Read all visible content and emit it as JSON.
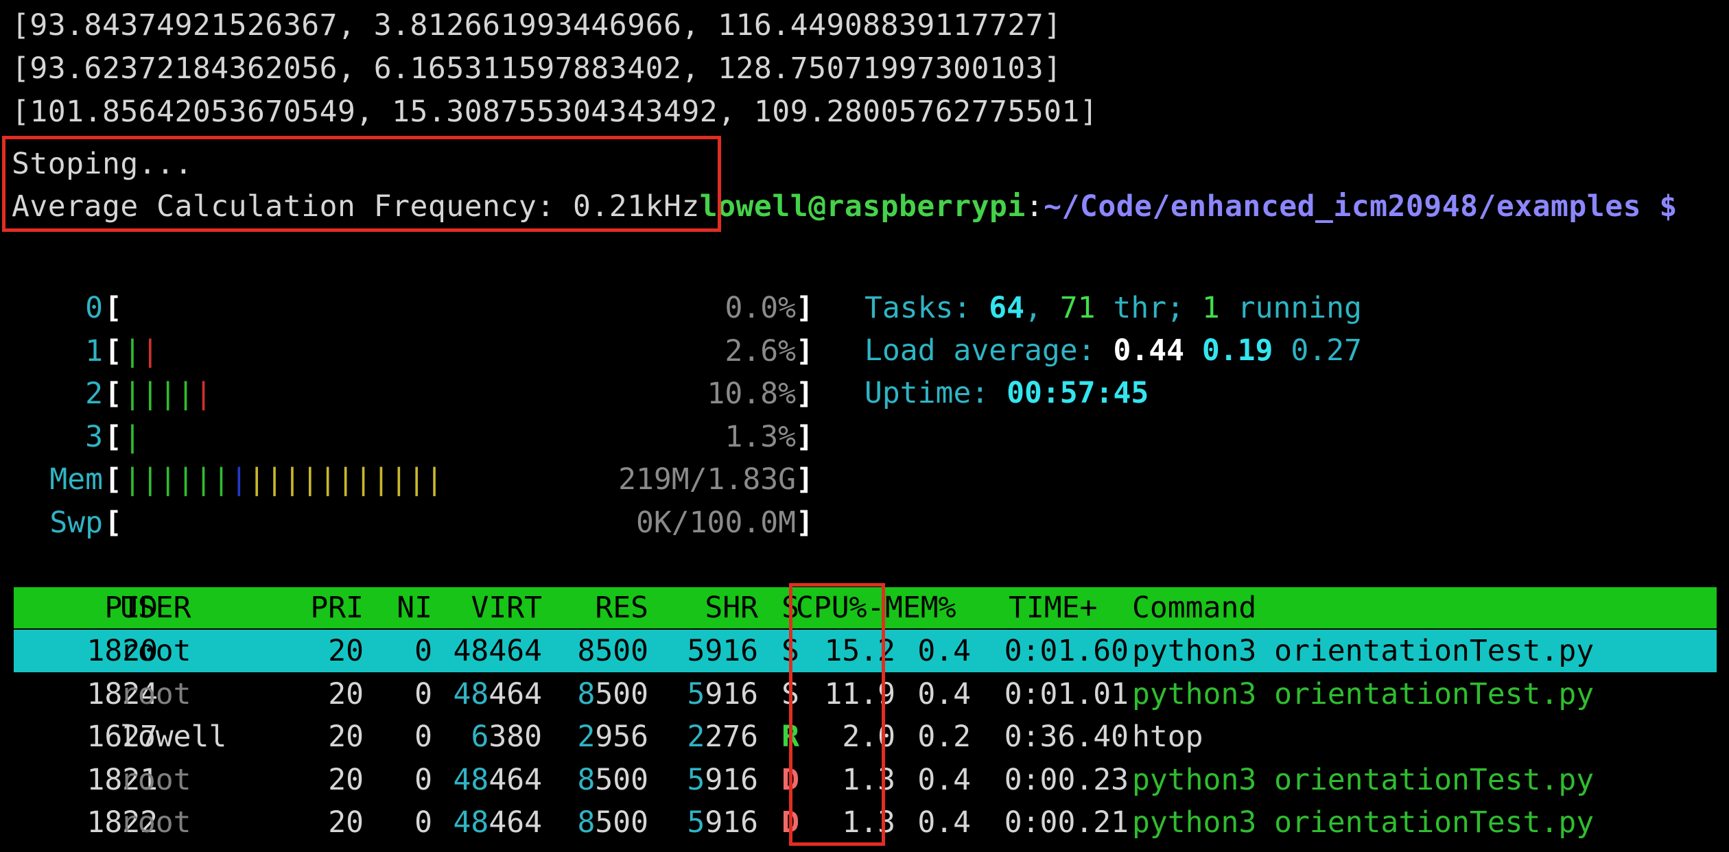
{
  "terminal": {
    "output_lines": [
      "[93.84374921526367, 3.812661993446966, 116.44908839117727]",
      "[93.62372184362056, 6.165311597883402, 128.75071997300103]",
      "[101.85642053670549, 15.308755304343492, 109.28005762775501]",
      "Stoping...",
      "Average Calculation Frequency: 0.21kHz"
    ],
    "prompt": {
      "user_host": "lowell@raspberrypi",
      "separator": ":",
      "path": "~/Code/enhanced_icm20948/examples",
      "symbol": " $"
    }
  },
  "htop": {
    "meters": [
      {
        "label": "0",
        "value": "0.0%",
        "bars": ""
      },
      {
        "label": "1",
        "value": "2.6%",
        "bars": "gr"
      },
      {
        "label": "2",
        "value": "10.8%",
        "bars": "ggggr"
      },
      {
        "label": "3",
        "value": "1.3%",
        "bars": "g"
      },
      {
        "label": "Mem",
        "value": "219M/1.83G",
        "bars": "ggggggbyyyyyyyyyyy"
      },
      {
        "label": "Swp",
        "value": "0K/100.0M",
        "bars": ""
      }
    ],
    "tasks": {
      "label": "Tasks:",
      "tasks": "64",
      "threads": "71",
      "thr_label": "thr;",
      "running": "1",
      "running_label": "running"
    },
    "load": {
      "label": "Load average:",
      "l1": "0.44",
      "l5": "0.19",
      "l15": "0.27"
    },
    "uptime": {
      "label": "Uptime:",
      "value": "00:57:45"
    },
    "columns": [
      "PID",
      "USER",
      "PRI",
      "NI",
      "VIRT",
      "RES",
      "SHR",
      "S",
      "CPU%-",
      "MEM%",
      "TIME+",
      "Command"
    ],
    "processes": [
      {
        "pid": "1820",
        "user": "root",
        "pri": "20",
        "ni": "0",
        "virt": "48464",
        "res": "8500",
        "shr": "5916",
        "s": "S",
        "cpu": "15.2",
        "mem": "0.4",
        "time": "0:01.60",
        "cmd": "python3 orientationTest.py"
      },
      {
        "pid": "1824",
        "user": "root",
        "pri": "20",
        "ni": "0",
        "virt": "48464",
        "res": "8500",
        "shr": "5916",
        "s": "S",
        "cpu": "11.9",
        "mem": "0.4",
        "time": "0:01.01",
        "cmd": "python3 orientationTest.py"
      },
      {
        "pid": "1627",
        "user": "lowell",
        "pri": "20",
        "ni": "0",
        "virt": "6380",
        "res": "2956",
        "shr": "2276",
        "s": "R",
        "cpu": "2.0",
        "mem": "0.2",
        "time": "0:36.40",
        "cmd": "htop"
      },
      {
        "pid": "1821",
        "user": "root",
        "pri": "20",
        "ni": "0",
        "virt": "48464",
        "res": "8500",
        "shr": "5916",
        "s": "D",
        "cpu": "1.3",
        "mem": "0.4",
        "time": "0:00.23",
        "cmd": "python3 orientationTest.py"
      },
      {
        "pid": "1822",
        "user": "root",
        "pri": "20",
        "ni": "0",
        "virt": "48464",
        "res": "8500",
        "shr": "5916",
        "s": "D",
        "cpu": "1.3",
        "mem": "0.4",
        "time": "0:00.21",
        "cmd": "python3 orientationTest.py"
      }
    ]
  },
  "colors": {
    "highlight_box": "#e22d22",
    "header_bg": "#17c417",
    "selected_row_bg": "#14c4c4"
  }
}
